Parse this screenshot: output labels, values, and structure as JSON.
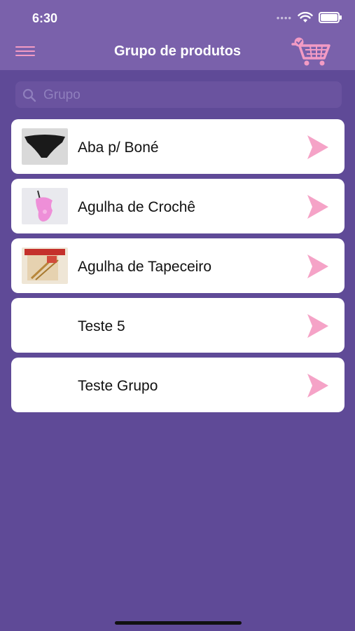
{
  "status_bar": {
    "time": "6:30"
  },
  "header": {
    "title": "Grupo de produtos",
    "menu_icon": "hamburger-icon",
    "cart_icon": "shopping-cart-icon"
  },
  "search": {
    "placeholder": "Grupo",
    "value": ""
  },
  "groups": [
    {
      "label": "Aba p/ Boné",
      "image": "visor-thumbnail"
    },
    {
      "label": "Agulha de Crochê",
      "image": "crochet-hook-thumbnail"
    },
    {
      "label": "Agulha de Tapeceiro",
      "image": "needle-pack-thumbnail"
    },
    {
      "label": "Teste 5",
      "image": ""
    },
    {
      "label": "Teste Grupo",
      "image": ""
    }
  ],
  "colors": {
    "background": "#5f4a97",
    "header": "#7a61ab",
    "accent_pink": "#f39bc4"
  }
}
